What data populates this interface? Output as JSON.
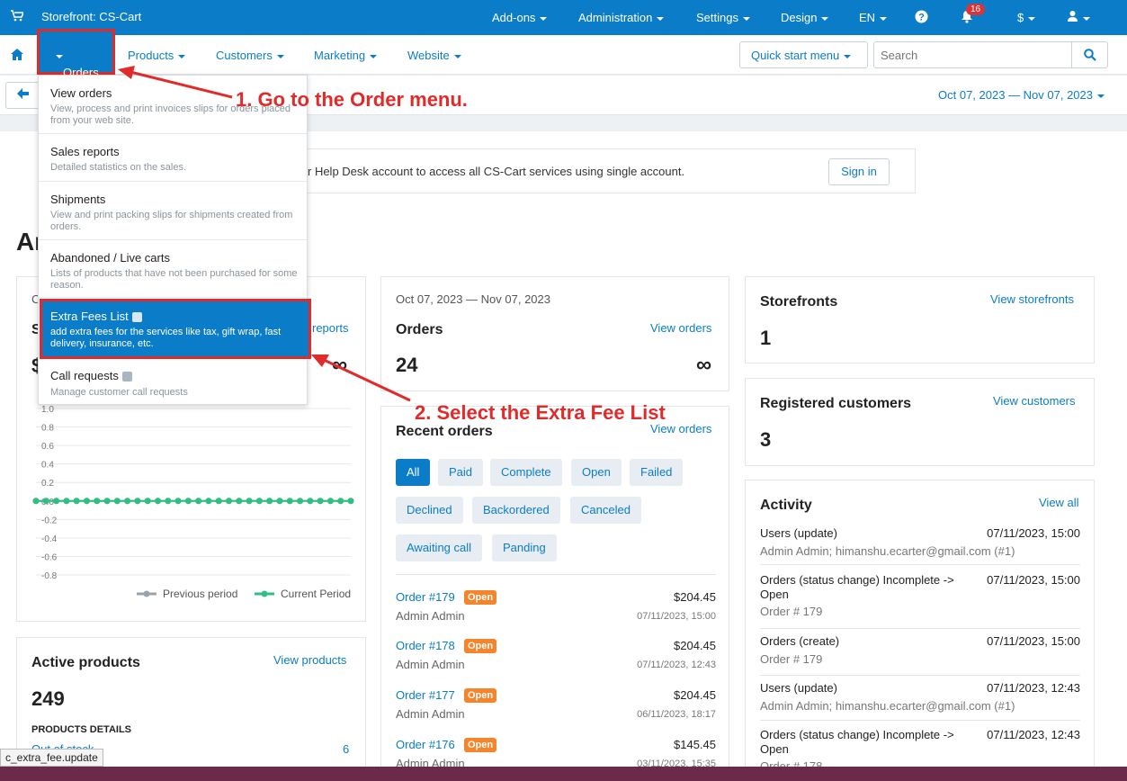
{
  "topbar": {
    "store_title": "Storefront: CS-Cart",
    "menus": [
      "Add-ons",
      "Administration",
      "Settings",
      "Design",
      "EN"
    ],
    "notifications_count": "16",
    "currency": "$"
  },
  "nav": {
    "orders": "Orders",
    "items": [
      "Products",
      "Customers",
      "Marketing",
      "Website"
    ],
    "quick_start": "Quick start menu",
    "search_placeholder": "Search"
  },
  "subbar": {
    "date_range": "Oct 07, 2023 — Nov 07, 2023"
  },
  "helpdesk": {
    "text": "r Help Desk account to access all CS-Cart services using single account.",
    "signin": "Sign in"
  },
  "page_heading": "Ar",
  "dropdown": [
    {
      "title": "View orders",
      "desc": "View, process and print invoices slips for orders placed from your web site."
    },
    {
      "title": "Sales reports",
      "desc": "Detailed statistics on the sales."
    },
    {
      "title": "Shipments",
      "desc": "View and print packing slips for shipments created from orders."
    },
    {
      "title": "Abandoned / Live carts",
      "desc": "Lists of products that have not been purchased for some reason."
    },
    {
      "title": "Extra Fees List",
      "desc": "add extra fees for the services like tax, gift wrap, fast delivery, insurance, etc."
    },
    {
      "title": "Call requests",
      "desc": "Manage customer call requests"
    }
  ],
  "annotations": {
    "step1": "1. Go to the Order menu.",
    "step2": "2. Select the Extra Fee List"
  },
  "sales_card": {
    "heading_partial": "S",
    "c_partial": "C",
    "dollar_partial": "$",
    "link_partial": "reports",
    "legend_previous": "Previous period",
    "legend_current": "Current Period"
  },
  "chart_data": {
    "type": "line",
    "y_ticks": [
      "1.0",
      "0.8",
      "0.6",
      "0.4",
      "0.2",
      "0.0",
      "-0.2",
      "-0.4",
      "-0.6",
      "-0.8"
    ],
    "ylim": [
      -0.8,
      1.0
    ],
    "series": [
      {
        "name": "Previous period",
        "color": "#9aa4ad",
        "values": [
          0,
          0,
          0,
          0,
          0,
          0,
          0,
          0,
          0,
          0,
          0,
          0,
          0,
          0,
          0,
          0,
          0,
          0,
          0,
          0,
          0,
          0,
          0,
          0,
          0,
          0,
          0,
          0,
          0,
          0,
          0,
          0
        ]
      },
      {
        "name": "Current Period",
        "color": "#2fbf83",
        "values": [
          0,
          0,
          0,
          0,
          0,
          0,
          0,
          0,
          0,
          0,
          0,
          0,
          0,
          0,
          0,
          0,
          0,
          0,
          0,
          0,
          0,
          0,
          0,
          0,
          0,
          0,
          0,
          0,
          0,
          0,
          0,
          0
        ]
      }
    ],
    "grid": true,
    "legend": "bottom-right"
  },
  "orders_card": {
    "date": "Oct 07, 2023 — Nov 07, 2023",
    "title": "Orders",
    "link": "View orders",
    "value": "24",
    "infinity": "∞"
  },
  "recent_orders": {
    "title": "Recent orders",
    "link": "View orders",
    "filters": [
      "All",
      "Paid",
      "Complete",
      "Open",
      "Failed",
      "Declined",
      "Backordered",
      "Canceled",
      "Awaiting call",
      "Panding"
    ],
    "rows": [
      {
        "id": "Order #179",
        "status": "Open",
        "amount": "$204.45",
        "customer": "Admin Admin",
        "date": "07/11/2023, 15:00"
      },
      {
        "id": "Order #178",
        "status": "Open",
        "amount": "$204.45",
        "customer": "Admin Admin",
        "date": "07/11/2023, 12:43"
      },
      {
        "id": "Order #177",
        "status": "Open",
        "amount": "$204.45",
        "customer": "Admin Admin",
        "date": "06/11/2023, 18:17"
      },
      {
        "id": "Order #176",
        "status": "Open",
        "amount": "$145.45",
        "customer": "Admin Admin",
        "date": "03/11/2023, 15:35"
      }
    ]
  },
  "storefronts": {
    "title": "Storefronts",
    "link": "View storefronts",
    "value": "1"
  },
  "registered": {
    "title": "Registered customers",
    "link": "View customers",
    "value": "3"
  },
  "activity": {
    "title": "Activity",
    "link": "View all",
    "rows": [
      {
        "title": "Users (update)",
        "date": "07/11/2023, 15:00",
        "sub": "Admin Admin; himanshu.ecarter@gmail.com (#1)"
      },
      {
        "title": "Orders (status change) Incomplete -> Open",
        "date": "07/11/2023, 15:00",
        "sub": "Order # 179"
      },
      {
        "title": "Orders (create)",
        "date": "07/11/2023, 15:00",
        "sub": "Order # 179"
      },
      {
        "title": "Users (update)",
        "date": "07/11/2023, 12:43",
        "sub": "Admin Admin; himanshu.ecarter@gmail.com (#1)"
      },
      {
        "title": "Orders (status change) Incomplete -> Open",
        "date": "07/11/2023, 12:43",
        "sub": "Order # 178"
      }
    ]
  },
  "active_products": {
    "title": "Active products",
    "link": "View products",
    "value": "249",
    "details_label": "PRODUCTS DETAILS",
    "out_of_stock": "Out of stock",
    "out_of_stock_count": "6"
  },
  "status_tooltip": "c_extra_fee.update"
}
